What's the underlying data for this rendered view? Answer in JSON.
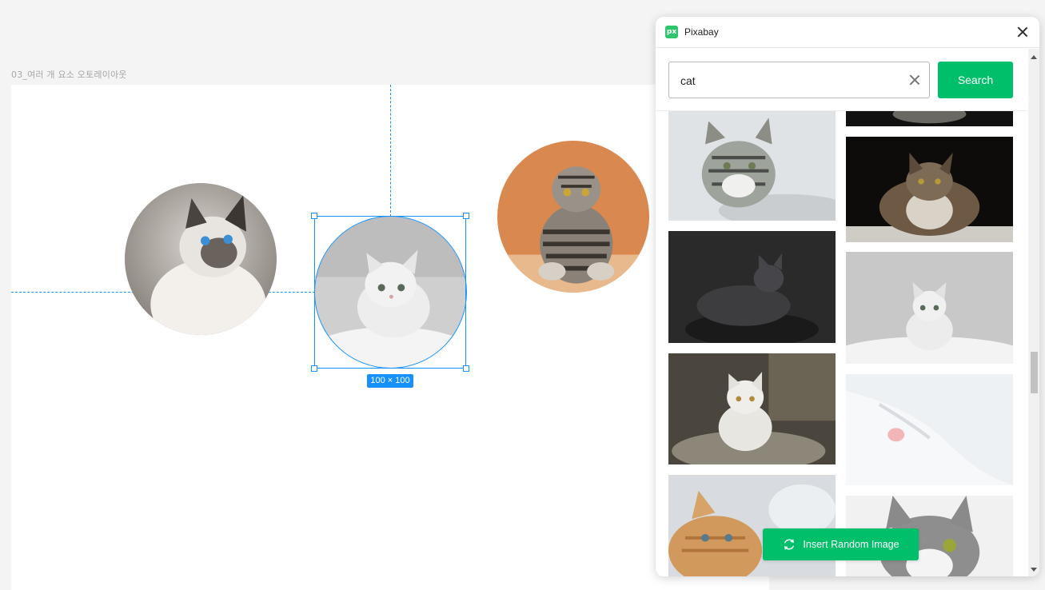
{
  "canvas": {
    "frame_label": "03_여러 개 요소 오토레이아웃",
    "selection_size": "100 × 100"
  },
  "panel": {
    "logo_text": "px",
    "title": "Pixabay",
    "search": {
      "value": "cat",
      "placeholder": ""
    },
    "search_button": "Search",
    "insert_random_button": "Insert Random Image"
  },
  "colors": {
    "accent_green": "#00bf6a",
    "selection_blue": "#1592ff"
  },
  "icons": [
    "pixabay-logo-icon",
    "close-icon",
    "clear-icon",
    "refresh-icon",
    "scroll-up-arrow-icon",
    "scroll-down-arrow-icon"
  ]
}
